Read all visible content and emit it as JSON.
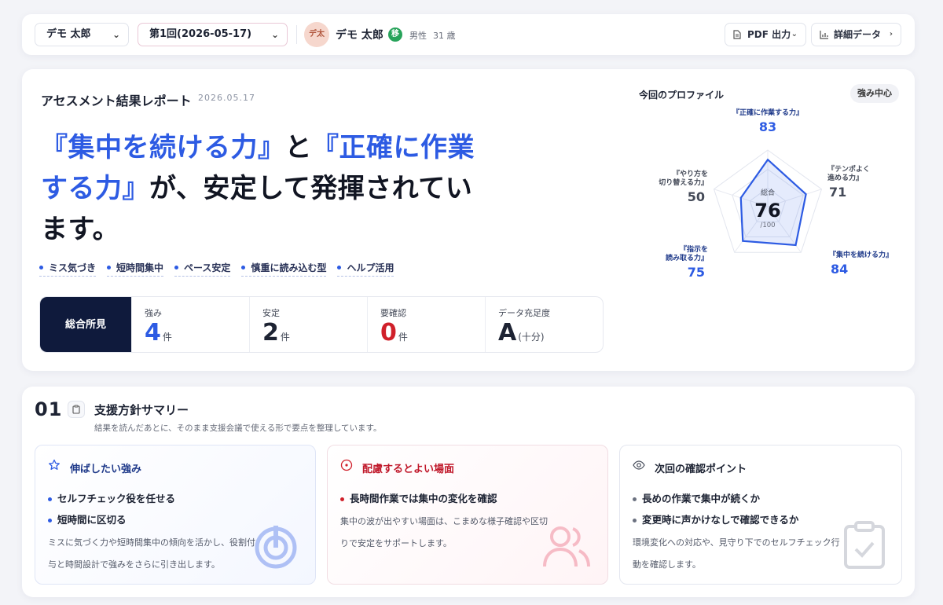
{
  "topbar": {
    "user_select": "デモ 太郎",
    "session_select": "第1回(2026-05-17)",
    "avatar_text": "デ太",
    "user_name": "デモ 太郎",
    "user_badge": "移",
    "gender": "男性",
    "age": "31 歳",
    "pdf_button": "PDF 出力",
    "detail_button": "詳細データ"
  },
  "report": {
    "title": "アセスメント結果レポート",
    "date": "2026.05.17",
    "headline": {
      "highlight_1": "『集中を続ける力』",
      "connector": "と",
      "highlight_2": "『正確に作業する力』",
      "rest": "が、安定して発揮されています。"
    },
    "tags": [
      "ミス気づき",
      "短時間集中",
      "ペース安定",
      "慎重に読み込む型",
      "ヘルプ活用"
    ],
    "summary_label": "総合所見",
    "stats": [
      {
        "label": "強み",
        "value": "4",
        "unit": "件",
        "color": "#2d5be3"
      },
      {
        "label": "安定",
        "value": "2",
        "unit": "件",
        "color": "#1d2333"
      },
      {
        "label": "要確認",
        "value": "0",
        "unit": "件",
        "color": "#d0202a"
      },
      {
        "label": "データ充足度",
        "value": "A",
        "unit": "(十分)",
        "color": "#1d2333"
      }
    ]
  },
  "profile": {
    "title": "今回のプロファイル",
    "pill": "強み中心",
    "center_label": "総合",
    "center_value": "76",
    "center_max": "/100",
    "axes": [
      {
        "label": "『正確に作業する力』",
        "score": 83,
        "lines": [
          "『正確に作業する力』"
        ],
        "score_text": "83",
        "color": "#2d5be3"
      },
      {
        "label": "『テンポよく進める力』",
        "score": 71,
        "lines": [
          "『テンポよく",
          "進める力』"
        ],
        "score_text": "71",
        "color": "#444a58"
      },
      {
        "label": "『集中を続ける力』",
        "score": 84,
        "lines": [
          "『集中を続ける力』"
        ],
        "score_text": "84",
        "color": "#2d5be3"
      },
      {
        "label": "『指示を読み取る力』",
        "score": 75,
        "lines": [
          "『指示を",
          "読み取る力』"
        ],
        "score_text": "75",
        "color": "#2d5be3"
      },
      {
        "label": "『やり方を切り替える力』",
        "score": 50,
        "lines": [
          "『やり方を",
          "切り替える力』"
        ],
        "score_text": "50",
        "color": "#444a58"
      }
    ],
    "accent_color": "#2d5be3"
  },
  "section": {
    "number": "01",
    "title": "支援方針サマリー",
    "subtitle": "結果を読んだあとに、そのまま支援会議で使える形で要点を整理しています。",
    "cards": [
      {
        "icon": "star-icon",
        "title": "伸ばしたい強み",
        "title_color": "#1f3a8a",
        "bullet_color": "#2d5be3",
        "items": [
          "セルフチェック役を任せる",
          "短時間に区切る"
        ],
        "desc": "ミスに気づく力や短時間集中の傾向を活かし、役割付与と時間設計で強みをさらに引き出します。"
      },
      {
        "icon": "target-icon",
        "title": "配慮するとよい場面",
        "title_color": "#c0182a",
        "bullet_color": "#d0202a",
        "items": [
          "長時間作業では集中の変化を確認"
        ],
        "desc": "集中の波が出やすい場面は、こまめな様子確認や区切りで安定をサポートします。"
      },
      {
        "icon": "eye-icon",
        "title": "次回の確認ポイント",
        "title_color": "#1d2333",
        "bullet_color": "#6b7180",
        "items": [
          "長めの作業で集中が続くか",
          "変更時に声かけなしで確認できるか"
        ],
        "desc": "環境変化への対応や、見守り下でのセルフチェック行動を確認します。"
      }
    ]
  }
}
